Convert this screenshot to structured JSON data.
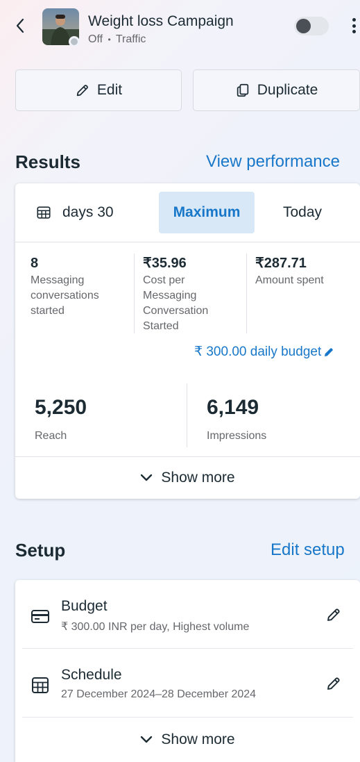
{
  "header": {
    "title": "Weight loss Campaign",
    "status": "Off",
    "separator": "•",
    "objective": "Traffic"
  },
  "actions": {
    "edit_label": "Edit",
    "duplicate_label": "Duplicate"
  },
  "results": {
    "title": "Results",
    "link": "View performance",
    "tabs": {
      "days30": "30 days",
      "maximum": "Maximum",
      "today": "Today"
    },
    "selected_tab": "Maximum",
    "metrics": [
      {
        "value": "8",
        "label": "Messaging conversations started"
      },
      {
        "value": "₹35.96",
        "label": "Cost per Messaging Conversation Started"
      },
      {
        "value": "₹287.71",
        "label": "Amount spent"
      }
    ],
    "budget_link": "₹ 300.00 daily budget",
    "reach": {
      "value": "5,250",
      "label": "Reach"
    },
    "impressions": {
      "value": "6,149",
      "label": "Impressions"
    },
    "show_more": "Show more"
  },
  "setup": {
    "title": "Setup",
    "link": "Edit setup",
    "budget": {
      "name": "Budget",
      "desc": "₹ 300.00 INR per day, Highest volume"
    },
    "schedule": {
      "name": "Schedule",
      "desc": "27 December 2024–28 December 2024"
    },
    "show_more": "Show more"
  },
  "colors": {
    "accent": "#1877c9",
    "selected_tab_bg": "#d8e8f6",
    "text": "#1c2b33",
    "muted": "#65676b"
  }
}
